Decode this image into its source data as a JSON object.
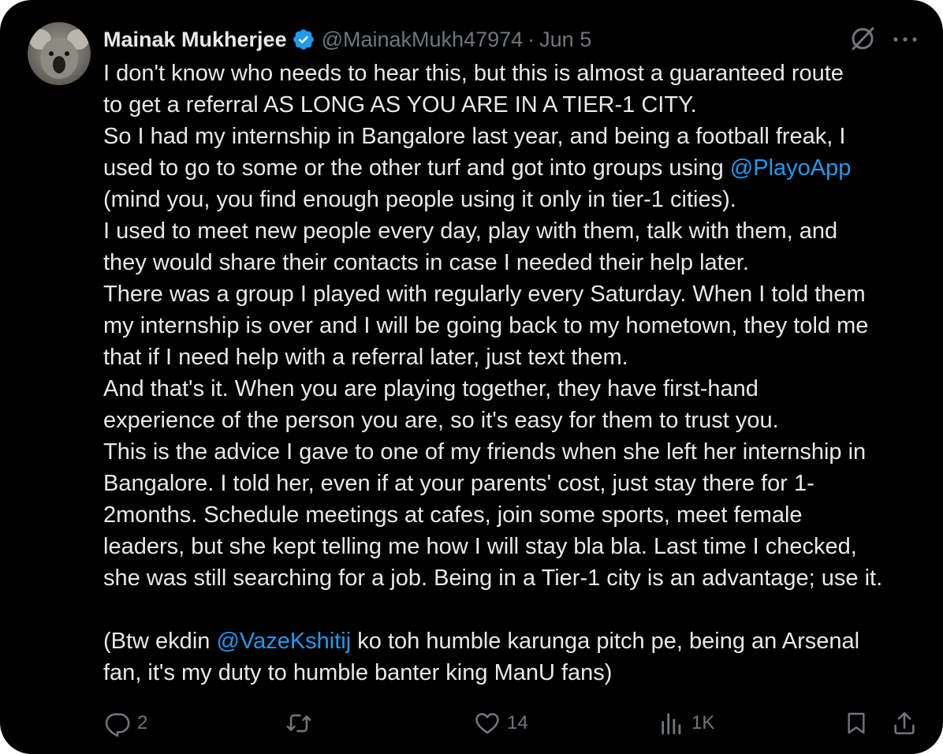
{
  "author": {
    "name": "Mainak Mukherjee",
    "handle": "@MainakMukh47974",
    "separator": "·",
    "date": "Jun 5"
  },
  "icons": {
    "avatar": "koala-avatar",
    "verified": "verified-badge-icon",
    "grok": "grok-icon",
    "more": "more-options-icon",
    "reply": "reply-icon",
    "retweet": "retweet-icon",
    "like": "heart-icon",
    "views": "views-icon",
    "bookmark": "bookmark-icon",
    "share": "share-icon"
  },
  "colors": {
    "background": "#000000",
    "text": "#e7e9ea",
    "muted": "#71767b",
    "accent": "#1d9bf0"
  },
  "tweet": {
    "lines": [
      "I don't know who needs to hear this, but this is almost a guaranteed route",
      "to get a referral AS LONG AS YOU ARE IN A TIER-1 CITY.",
      "So I had my internship in Bangalore last year, and being a football freak, I",
      "used to go to some or the other turf and got into groups using ",
      "(mind you, you find enough people using it only in tier-1 cities).",
      "I used to meet new people every day, play with them, talk with them, and",
      "they would share their contacts in case I needed their help later.",
      "There was a group I played with regularly every Saturday. When I told them",
      "my internship is over and I will be going back to my hometown, they told me",
      "that if I need help with a referral later, just text them.",
      "And that's it. When you are playing together, they have first-hand",
      "experience of the person you are, so it's easy for them to trust you.",
      "This is the advice I gave to one of my friends when she left her internship in",
      "Bangalore. I told her, even if at your parents' cost, just stay there for 1-",
      "2months. Schedule meetings at cafes, join some sports, meet female",
      "leaders, but she kept telling me how I will stay bla bla. Last time I checked,",
      "she was still searching for a job. Being in a Tier-1 city is an advantage; use it.",
      "(Btw ekdin ",
      " ko toh humble karunga pitch pe, being an Arsenal",
      "fan, it's my duty to humble banter king ManU fans)"
    ],
    "mentions": {
      "playo": "@PlayoApp",
      "vaze": "@VazeKshitij"
    }
  },
  "stats": {
    "replies": "2",
    "likes": "14",
    "views": "1K"
  }
}
